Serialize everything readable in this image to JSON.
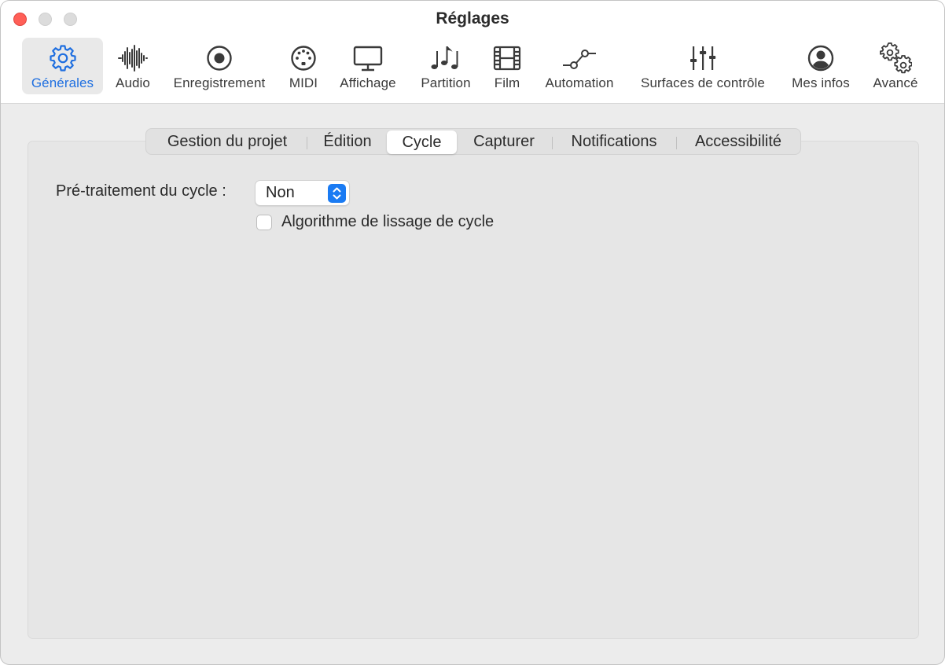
{
  "window": {
    "title": "Réglages"
  },
  "toolbar": {
    "items": [
      {
        "label": "Générales",
        "icon": "gear-icon",
        "selected": true
      },
      {
        "label": "Audio",
        "icon": "waveform-icon"
      },
      {
        "label": "Enregistrement",
        "icon": "record-icon"
      },
      {
        "label": "MIDI",
        "icon": "midi-connector-icon"
      },
      {
        "label": "Affichage",
        "icon": "display-icon"
      },
      {
        "label": "Partition",
        "icon": "music-notes-icon"
      },
      {
        "label": "Film",
        "icon": "film-strip-icon"
      },
      {
        "label": "Automation",
        "icon": "automation-curve-icon"
      },
      {
        "label": "Surfaces de contrôle",
        "icon": "sliders-icon"
      },
      {
        "label": "Mes infos",
        "icon": "person-circle-icon"
      },
      {
        "label": "Avancé",
        "icon": "gears-icon"
      }
    ]
  },
  "tabs": {
    "items": [
      {
        "label": "Gestion du projet"
      },
      {
        "label": "Édition"
      },
      {
        "label": "Cycle",
        "active": true
      },
      {
        "label": "Capturer"
      },
      {
        "label": "Notifications"
      },
      {
        "label": "Accessibilité"
      }
    ]
  },
  "cycle": {
    "pretraitement_label": "Pré-traitement du cycle :",
    "pretraitement_value": "Non",
    "lissage_label": "Algorithme de lissage de cycle",
    "lissage_checked": false
  },
  "colors": {
    "accent": "#1f6fe0",
    "popup_stepper": "#1a7bf3",
    "close_button": "#ff5f57"
  }
}
